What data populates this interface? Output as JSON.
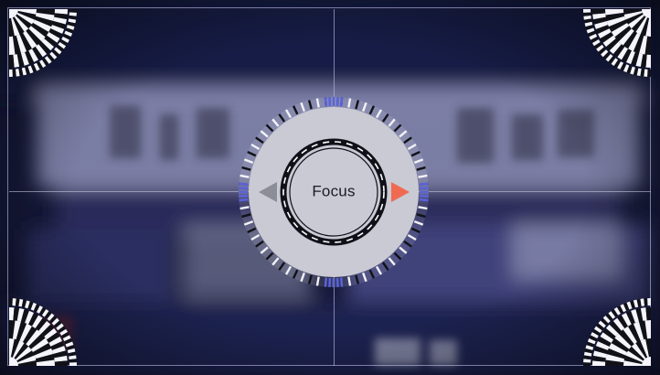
{
  "viewfinder": {
    "focus_label": "Focus"
  },
  "icons": {
    "left": "triangle-left-icon",
    "right": "triangle-right-icon",
    "corners": "corner-dial-icon"
  },
  "colors": {
    "background": "#10122c",
    "dial_face": "#c9cad3",
    "dial_ring": "#101018",
    "arrow_left": "#8b8d97",
    "arrow_right": "#f06a52",
    "tick_blue": "#5a63d8"
  }
}
